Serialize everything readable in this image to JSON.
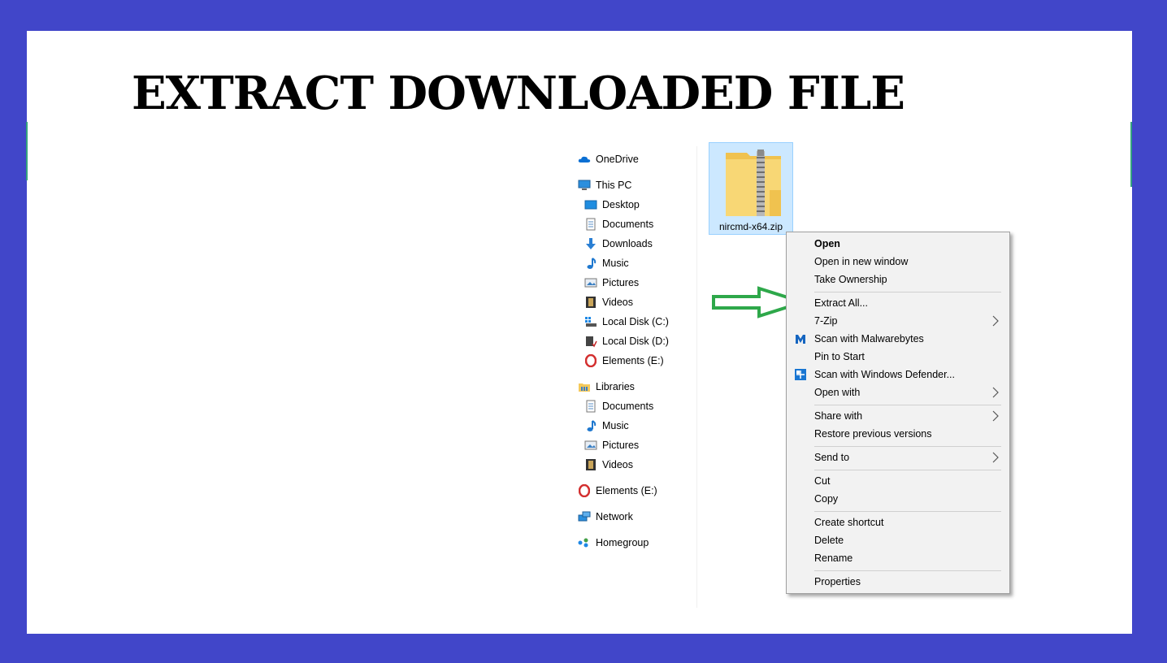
{
  "title": "EXTRACT DOWNLOADED FILE",
  "nav": {
    "items": [
      {
        "label": "OneDrive",
        "icon": "onedrive-icon"
      },
      {
        "label": "This PC",
        "icon": "this-pc-icon"
      },
      {
        "label": "Desktop",
        "icon": "desktop-icon"
      },
      {
        "label": "Documents",
        "icon": "documents-icon"
      },
      {
        "label": "Downloads",
        "icon": "downloads-icon"
      },
      {
        "label": "Music",
        "icon": "music-icon"
      },
      {
        "label": "Pictures",
        "icon": "pictures-icon"
      },
      {
        "label": "Videos",
        "icon": "videos-icon"
      },
      {
        "label": "Local Disk (C:)",
        "icon": "drive-c-icon"
      },
      {
        "label": "Local Disk (D:)",
        "icon": "drive-d-icon"
      },
      {
        "label": "Elements (E:)",
        "icon": "opera-drive-icon"
      },
      {
        "label": "Libraries",
        "icon": "libraries-icon"
      },
      {
        "label": "Documents",
        "icon": "documents-icon"
      },
      {
        "label": "Music",
        "icon": "music-icon"
      },
      {
        "label": "Pictures",
        "icon": "pictures-icon"
      },
      {
        "label": "Videos",
        "icon": "videos-icon"
      },
      {
        "label": "Elements (E:)",
        "icon": "opera-drive-icon"
      },
      {
        "label": "Network",
        "icon": "network-icon"
      },
      {
        "label": "Homegroup",
        "icon": "homegroup-icon"
      }
    ]
  },
  "file": {
    "name": "nircmd-x64.zip",
    "icon": "zip-folder-icon"
  },
  "context_menu": {
    "items": [
      {
        "label": "Open",
        "bold": true
      },
      {
        "label": "Open in new window"
      },
      {
        "label": "Take Ownership"
      },
      {
        "label": "Extract All..."
      },
      {
        "label": "7-Zip",
        "submenu": true
      },
      {
        "label": "Scan with Malwarebytes",
        "icon": "malwarebytes-icon"
      },
      {
        "label": "Pin to Start"
      },
      {
        "label": "Scan with Windows Defender...",
        "icon": "windows-defender-icon"
      },
      {
        "label": "Open with",
        "submenu": true
      },
      {
        "label": "Share with",
        "submenu": true
      },
      {
        "label": "Restore previous versions"
      },
      {
        "label": "Send to",
        "submenu": true
      },
      {
        "label": "Cut"
      },
      {
        "label": "Copy"
      },
      {
        "label": "Create shortcut"
      },
      {
        "label": "Delete"
      },
      {
        "label": "Rename"
      },
      {
        "label": "Properties"
      }
    ]
  },
  "colors": {
    "background": "#4146c9",
    "highlight": "#cce8ff",
    "arrow": "#2ea84a"
  },
  "annotation": {
    "icon": "green-arrow-icon"
  }
}
